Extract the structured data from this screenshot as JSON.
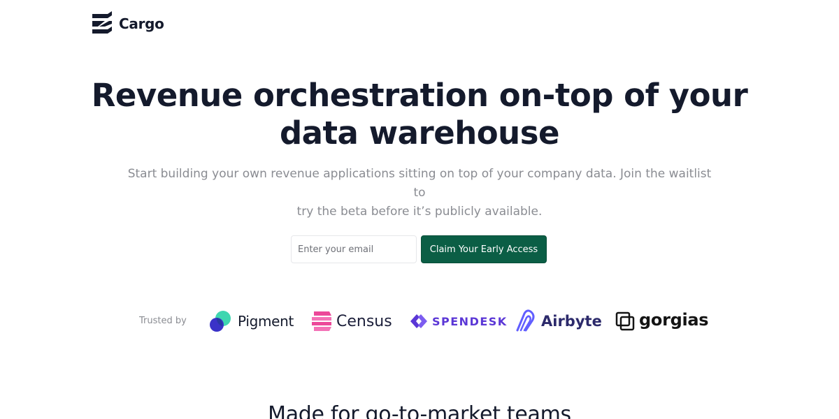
{
  "brand": {
    "name": "Cargo",
    "icon": "cargo-logo-icon",
    "color": "#141a2c"
  },
  "hero": {
    "title_line1": "Revenue orchestration on-top of your",
    "title_line2": "data warehouse",
    "subtitle_line1": "Start building your own revenue applications sitting on top of your company data. Join the waitlist to",
    "subtitle_line2": "try the beta before it’s publicly available."
  },
  "signup": {
    "email_placeholder": "Enter your email",
    "email_value": "",
    "cta_label": "Claim Your Early Access",
    "cta_color": "#0b5e45"
  },
  "trusted": {
    "label": "Trusted by",
    "logos": [
      {
        "name": "Pigment",
        "icon": "pigment-logo-icon",
        "color": "#141a2c"
      },
      {
        "name": "Census",
        "icon": "census-logo-icon",
        "color": "#ec4899"
      },
      {
        "name": "SPENDESK",
        "icon": "spendesk-logo-icon",
        "color": "#5b37d6"
      },
      {
        "name": "Airbyte",
        "icon": "airbyte-logo-icon",
        "color": "#615eff"
      },
      {
        "name": "gorgias",
        "icon": "gorgias-logo-icon",
        "color": "#141414"
      }
    ]
  },
  "next_section": {
    "heading": "Made for go-to-market teams"
  }
}
